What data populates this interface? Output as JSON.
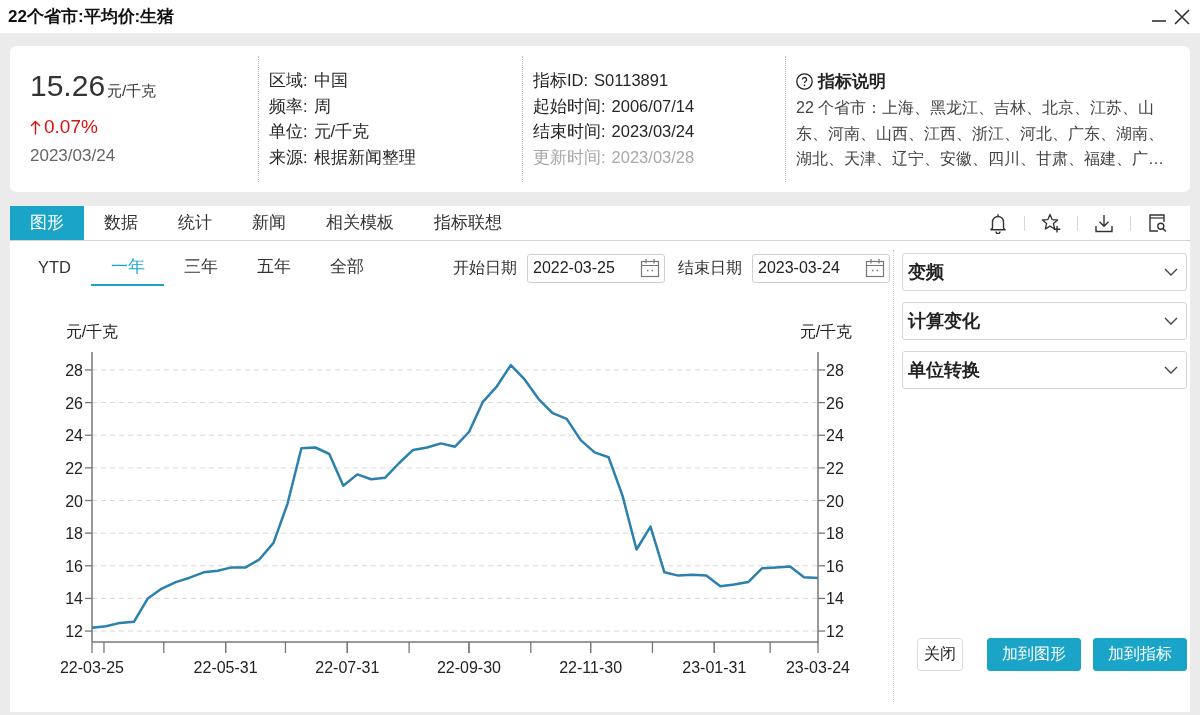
{
  "window": {
    "title": "22个省市:平均价:生猪"
  },
  "summary": {
    "value": "15.26",
    "unit": "元/千克",
    "change": {
      "rising": true,
      "text": "0.07%"
    },
    "date": "2023/03/24"
  },
  "attributes": [
    {
      "label": "区域:",
      "value": "中国"
    },
    {
      "label": "频率:",
      "value": "周"
    },
    {
      "label": "单位:",
      "value": "元/千克"
    },
    {
      "label": "来源:",
      "value": "根据新闻整理"
    }
  ],
  "details": [
    {
      "label": "指标ID:",
      "value": "S0113891",
      "muted": false
    },
    {
      "label": "起始时间:",
      "value": "2006/07/14",
      "muted": false
    },
    {
      "label": "结束时间:",
      "value": "2023/03/24",
      "muted": false
    },
    {
      "label": "更新时间:",
      "value": "2023/03/28",
      "muted": true
    }
  ],
  "description": {
    "title": "指标说明",
    "text": "22 个省市：上海、黑龙江、吉林、北京、江苏、山东、河南、山西、江西、浙江、河北、广东、湖南、湖北、天津、辽宁、安徽、四川、甘肃、福建、广…"
  },
  "tabs": [
    {
      "label": "图形",
      "selected": true
    },
    {
      "label": "数据",
      "selected": false
    },
    {
      "label": "统计",
      "selected": false
    },
    {
      "label": "新闻",
      "selected": false
    },
    {
      "label": "相关模板",
      "selected": false
    },
    {
      "label": "指标联想",
      "selected": false
    }
  ],
  "ranges": [
    {
      "label": "YTD",
      "selected": false
    },
    {
      "label": "一年",
      "selected": true
    },
    {
      "label": "三年",
      "selected": false
    },
    {
      "label": "五年",
      "selected": false
    },
    {
      "label": "全部",
      "selected": false
    }
  ],
  "date_filters": [
    {
      "label": "开始日期",
      "value": "2022-03-25"
    },
    {
      "label": "结束日期",
      "value": "2023-03-24"
    }
  ],
  "chart_panel": {
    "chart_data": {
      "type": "line",
      "ylabel": "元/千克",
      "x": [
        "2022-03-25",
        "2022-04-01",
        "2022-04-08",
        "2022-04-15",
        "2022-04-22",
        "2022-04-29",
        "2022-05-06",
        "2022-05-13",
        "2022-05-20",
        "2022-05-27",
        "2022-06-03",
        "2022-06-10",
        "2022-06-17",
        "2022-06-24",
        "2022-07-01",
        "2022-07-08",
        "2022-07-15",
        "2022-07-22",
        "2022-07-29",
        "2022-08-05",
        "2022-08-12",
        "2022-08-19",
        "2022-08-26",
        "2022-09-02",
        "2022-09-09",
        "2022-09-16",
        "2022-09-23",
        "2022-09-30",
        "2022-10-07",
        "2022-10-14",
        "2022-10-21",
        "2022-10-28",
        "2022-11-04",
        "2022-11-11",
        "2022-11-18",
        "2022-11-25",
        "2022-12-02",
        "2022-12-09",
        "2022-12-16",
        "2022-12-23",
        "2022-12-30",
        "2023-01-06",
        "2023-01-13",
        "2023-01-20",
        "2023-01-27",
        "2023-02-03",
        "2023-02-10",
        "2023-02-17",
        "2023-02-24",
        "2023-03-03",
        "2023-03-10",
        "2023-03-17",
        "2023-03-24"
      ],
      "series": [
        {
          "color": "#2b80ad",
          "values": [
            12.2,
            12.3,
            12.5,
            12.57,
            14.0,
            14.6,
            15.0,
            15.27,
            15.6,
            15.7,
            15.9,
            15.9,
            16.4,
            17.4,
            19.8,
            23.2,
            23.25,
            22.85,
            20.9,
            21.6,
            21.3,
            21.4,
            22.3,
            23.1,
            23.25,
            23.5,
            23.3,
            24.2,
            26.05,
            27.0,
            28.3,
            27.4,
            26.2,
            25.35,
            25.0,
            23.7,
            22.95,
            22.65,
            20.3,
            17.0,
            18.4,
            15.6,
            15.4,
            15.45,
            15.4,
            14.75,
            14.85,
            15.0,
            15.85,
            15.9,
            15.95,
            15.3,
            15.26
          ]
        }
      ],
      "xlim": [
        "2022-03-25",
        "2023-03-24"
      ],
      "ylim": [
        11.33,
        29.1
      ],
      "yticks": [
        12,
        14,
        16,
        18,
        20,
        22,
        24,
        26,
        28
      ],
      "xticks": [
        {
          "value": "2022-03-25",
          "label": "22-03-25"
        },
        {
          "value": "2022-05-31",
          "label": "22-05-31"
        },
        {
          "value": "2022-07-31",
          "label": "22-07-31"
        },
        {
          "value": "2022-09-30",
          "label": "22-09-30"
        },
        {
          "value": "2022-11-30",
          "label": "22-11-30"
        },
        {
          "value": "2023-01-31",
          "label": "23-01-31"
        },
        {
          "value": "2023-03-24",
          "label": "23-03-24"
        }
      ],
      "grid": true
    },
    "right_axis": {
      "label": "元/千克",
      "ticks": [
        "28",
        "26",
        "24",
        "22",
        "20",
        "18",
        "16",
        "14",
        "12"
      ]
    }
  },
  "dropdowns": [
    {
      "label": "变频"
    },
    {
      "label": "计算变化"
    },
    {
      "label": "单位转换"
    }
  ],
  "buttons": [
    {
      "label": "关闭",
      "kind": "secondary"
    },
    {
      "label": "加到图形",
      "kind": "primary"
    },
    {
      "label": "加到指标",
      "kind": "primary"
    }
  ]
}
